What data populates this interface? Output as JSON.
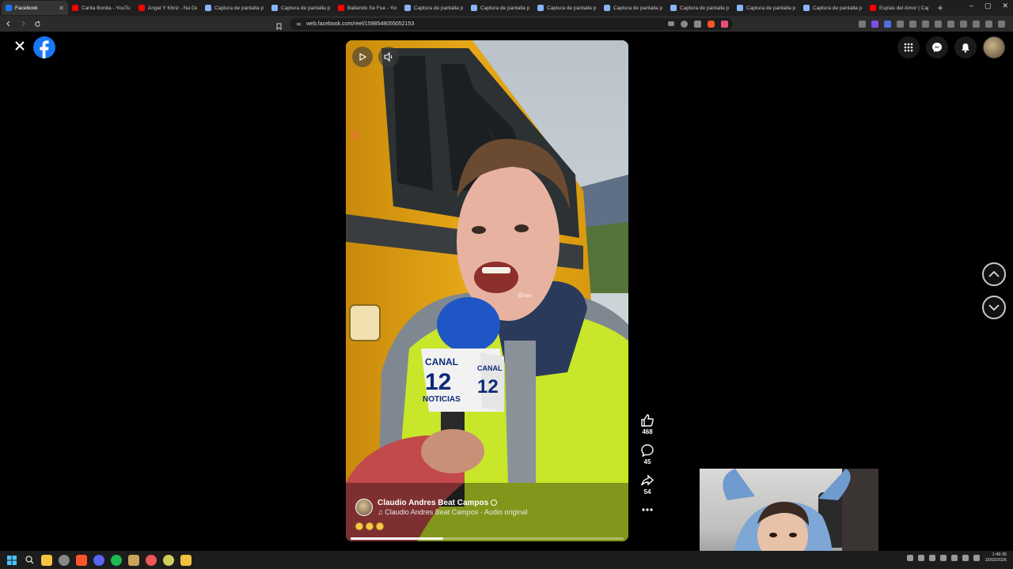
{
  "browser": {
    "tabs": [
      {
        "label": "Facebook",
        "active": true,
        "favicon_color": "#1877f2"
      },
      {
        "label": "Carita Bonita - YouTube",
        "favicon_color": "#ff0000"
      },
      {
        "label": "Angel Y Khriz - Na De",
        "favicon_color": "#ff0000"
      },
      {
        "label": "Captura de pantalla p",
        "favicon_color": "#8ab4f8"
      },
      {
        "label": "Captura de pantalla p",
        "favicon_color": "#8ab4f8"
      },
      {
        "label": "Bailando Se Fue - You",
        "favicon_color": "#ff0000"
      },
      {
        "label": "Captura de pantalla p",
        "favicon_color": "#8ab4f8"
      },
      {
        "label": "Captura de pantalla p",
        "favicon_color": "#8ab4f8"
      },
      {
        "label": "Captura de pantalla p",
        "favicon_color": "#8ab4f8"
      },
      {
        "label": "Captura de pantalla p",
        "favicon_color": "#8ab4f8"
      },
      {
        "label": "Captura de pantalla p",
        "favicon_color": "#8ab4f8"
      },
      {
        "label": "Captura de pantalla p",
        "favicon_color": "#8ab4f8"
      },
      {
        "label": "Captura de pantalla p",
        "favicon_color": "#8ab4f8"
      },
      {
        "label": "Espías del Amor | Cap",
        "favicon_color": "#ff0000"
      }
    ],
    "url": "web.facebook.com/reel/1598548055052153",
    "window_controls": {
      "minimize": "–",
      "maximize": "▢",
      "close": "✕"
    }
  },
  "reel": {
    "author_name": "Claudio Andres Beat Campos",
    "audio_text": "♫ Claudio Andres Beat Campos · Audio original",
    "watermark": "@xav",
    "progress": 0.34,
    "likes": "468",
    "comments": "45",
    "shares": "54"
  },
  "colors": {
    "facebook_blue": "#1877f2",
    "page_bg": "#000000",
    "bus_yellow": "#e6a817",
    "vest_green": "#c8e62a"
  },
  "icons": [
    "close-icon",
    "facebook-logo-icon",
    "apps-grid-icon",
    "messenger-icon",
    "bell-icon",
    "play-icon",
    "volume-icon",
    "like-icon",
    "comment-icon",
    "share-icon",
    "more-icon",
    "chevron-up-icon",
    "chevron-down-icon"
  ],
  "taskbar": {
    "time": "1:49:35",
    "date": "15/03/2026"
  }
}
